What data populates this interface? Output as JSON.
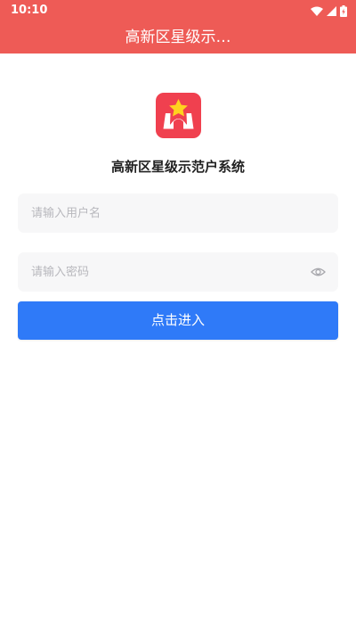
{
  "status_bar": {
    "time": "10:10",
    "icons": [
      "wifi-icon",
      "cell-signal-icon",
      "battery-icon"
    ]
  },
  "header": {
    "title": "高新区星级示…"
  },
  "app": {
    "title": "高新区星级示范户系统",
    "logo_icon": "star-house-logo"
  },
  "form": {
    "username_placeholder": "请输入用户名",
    "username_value": "",
    "password_placeholder": "请输入密码",
    "password_value": "",
    "login_label": "点击进入",
    "toggle_icon": "eye-icon"
  },
  "colors": {
    "header_bg": "#ee5b56",
    "logo_bg": "#f0404f",
    "star": "#ffd21f",
    "button_bg": "#2f7af8",
    "input_bg": "#f7f7f8"
  }
}
